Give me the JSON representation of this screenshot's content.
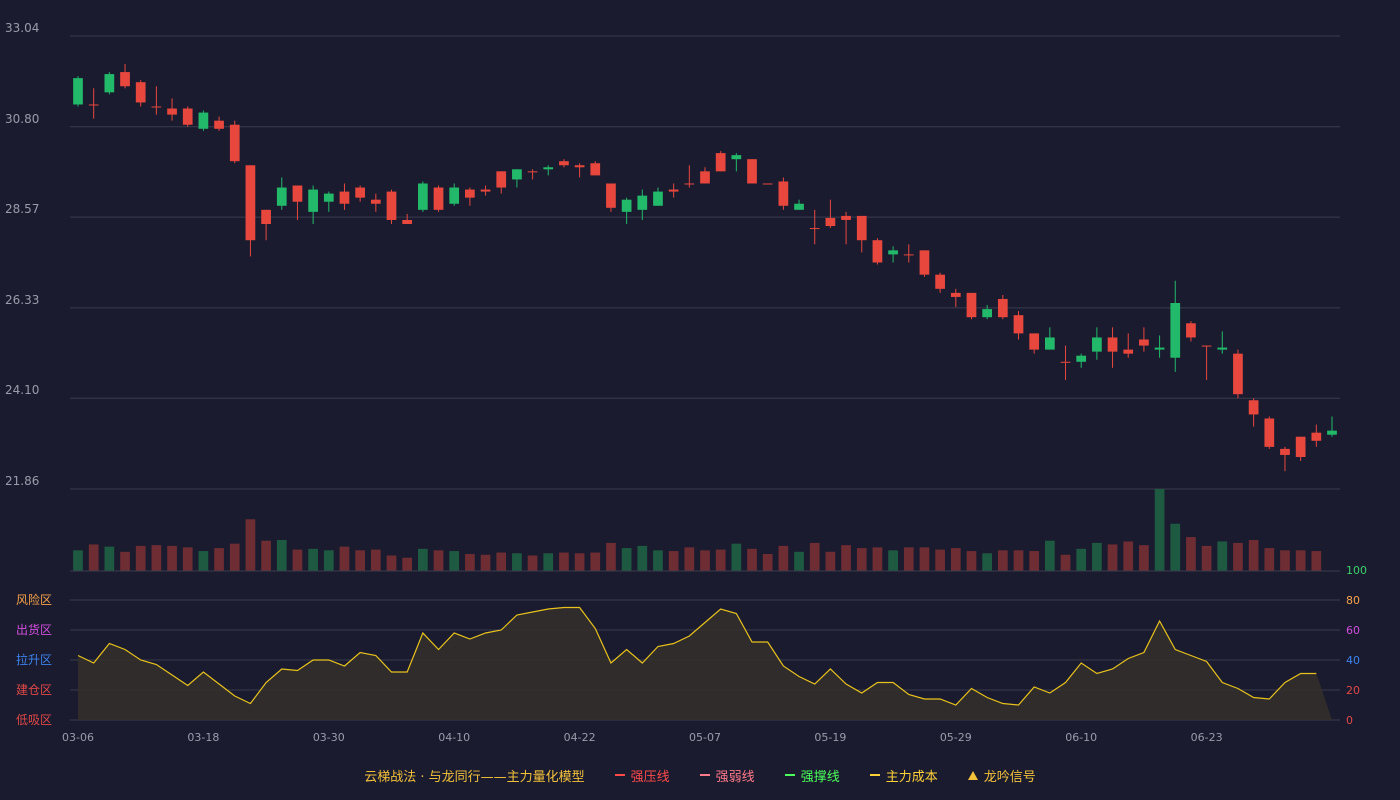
{
  "chart_data": {
    "type": "candlestick",
    "price_axis": {
      "ticks": [
        33.04,
        30.8,
        28.57,
        26.33,
        24.1,
        21.86
      ],
      "ylim": [
        21.86,
        33.04
      ]
    },
    "x_ticks": [
      "03-06",
      "03-18",
      "03-30",
      "04-10",
      "04-22",
      "05-07",
      "05-19",
      "05-29",
      "06-10",
      "06-23"
    ],
    "x_tick_index": [
      0,
      8,
      16,
      24,
      32,
      40,
      48,
      56,
      64,
      72
    ],
    "candles": [
      [
        32.0,
        31.35,
        32.05,
        31.3
      ],
      [
        31.35,
        31.35,
        31.75,
        31.0
      ],
      [
        32.1,
        31.65,
        32.15,
        31.6
      ],
      [
        31.8,
        32.15,
        32.35,
        31.75
      ],
      [
        31.4,
        31.9,
        31.95,
        31.3
      ],
      [
        31.3,
        31.3,
        31.8,
        31.1
      ],
      [
        31.1,
        31.25,
        31.5,
        30.95
      ],
      [
        30.85,
        31.25,
        31.3,
        30.8
      ],
      [
        31.15,
        30.75,
        31.2,
        30.7
      ],
      [
        30.75,
        30.95,
        31.05,
        30.7
      ],
      [
        29.95,
        30.85,
        30.95,
        29.9
      ],
      [
        28.0,
        29.85,
        29.85,
        27.6
      ],
      [
        28.4,
        28.75,
        28.75,
        28.0
      ],
      [
        29.3,
        28.85,
        29.55,
        28.75
      ],
      [
        28.95,
        29.35,
        29.35,
        28.5
      ],
      [
        29.25,
        28.7,
        29.35,
        28.4
      ],
      [
        29.15,
        28.95,
        29.2,
        28.7
      ],
      [
        28.9,
        29.2,
        29.4,
        28.75
      ],
      [
        29.05,
        29.3,
        29.35,
        28.95
      ],
      [
        28.9,
        29.0,
        29.15,
        28.7
      ],
      [
        28.5,
        29.2,
        29.25,
        28.4
      ],
      [
        28.4,
        28.5,
        28.65,
        28.4
      ],
      [
        29.4,
        28.75,
        29.45,
        28.7
      ],
      [
        28.75,
        29.3,
        29.35,
        28.7
      ],
      [
        29.3,
        28.9,
        29.4,
        28.85
      ],
      [
        29.05,
        29.25,
        29.3,
        28.85
      ],
      [
        29.2,
        29.25,
        29.35,
        29.1
      ],
      [
        29.3,
        29.7,
        29.7,
        29.15
      ],
      [
        29.75,
        29.5,
        29.75,
        29.3
      ],
      [
        29.7,
        29.7,
        29.75,
        29.5
      ],
      [
        29.8,
        29.75,
        29.85,
        29.6
      ],
      [
        29.85,
        29.95,
        30.0,
        29.8
      ],
      [
        29.8,
        29.85,
        29.9,
        29.55
      ],
      [
        29.6,
        29.9,
        29.95,
        29.6
      ],
      [
        28.8,
        29.4,
        29.4,
        28.7
      ],
      [
        29.0,
        28.7,
        29.05,
        28.4
      ],
      [
        29.1,
        28.75,
        29.25,
        28.5
      ],
      [
        29.2,
        28.85,
        29.3,
        28.85
      ],
      [
        29.2,
        29.25,
        29.4,
        29.05
      ],
      [
        29.4,
        29.4,
        29.85,
        29.3
      ],
      [
        29.4,
        29.7,
        29.8,
        29.4
      ],
      [
        29.7,
        30.15,
        30.2,
        29.7
      ],
      [
        30.1,
        30.0,
        30.15,
        29.7
      ],
      [
        29.4,
        30.0,
        30.0,
        29.4
      ],
      [
        29.4,
        29.4,
        29.4,
        29.4
      ],
      [
        28.85,
        29.45,
        29.55,
        28.75
      ],
      [
        28.9,
        28.75,
        29.0,
        28.75
      ],
      [
        28.3,
        28.3,
        28.75,
        27.9
      ],
      [
        28.35,
        28.55,
        29.0,
        28.3
      ],
      [
        28.5,
        28.6,
        28.7,
        27.9
      ],
      [
        28.0,
        28.6,
        28.6,
        27.7
      ],
      [
        27.45,
        28.0,
        28.05,
        27.4
      ],
      [
        27.75,
        27.65,
        27.85,
        27.45
      ],
      [
        27.65,
        27.65,
        27.9,
        27.45
      ],
      [
        27.15,
        27.75,
        27.75,
        27.1
      ],
      [
        26.8,
        27.15,
        27.2,
        26.7
      ],
      [
        26.6,
        26.7,
        26.8,
        26.35
      ],
      [
        26.1,
        26.7,
        26.7,
        26.05
      ],
      [
        26.3,
        26.1,
        26.4,
        26.05
      ],
      [
        26.1,
        26.55,
        26.65,
        26.05
      ],
      [
        25.7,
        26.15,
        26.25,
        25.55
      ],
      [
        25.3,
        25.7,
        25.7,
        25.2
      ],
      [
        25.6,
        25.3,
        25.85,
        25.3
      ],
      [
        25.0,
        25.0,
        25.4,
        24.55
      ],
      [
        25.15,
        25.0,
        25.2,
        24.85
      ],
      [
        25.6,
        25.25,
        25.85,
        25.05
      ],
      [
        25.25,
        25.6,
        25.85,
        24.85
      ],
      [
        25.2,
        25.3,
        25.7,
        25.1
      ],
      [
        25.4,
        25.55,
        25.85,
        25.25
      ],
      [
        25.35,
        25.3,
        25.65,
        25.1
      ],
      [
        26.45,
        25.1,
        27.0,
        24.75
      ],
      [
        25.6,
        25.95,
        26.0,
        25.5
      ],
      [
        25.4,
        25.4,
        25.4,
        24.55
      ],
      [
        25.35,
        25.3,
        25.75,
        25.2
      ],
      [
        24.2,
        25.2,
        25.3,
        24.1
      ],
      [
        23.7,
        24.05,
        24.1,
        23.4
      ],
      [
        22.9,
        23.6,
        23.65,
        22.85
      ],
      [
        22.7,
        22.85,
        22.9,
        22.3
      ],
      [
        22.65,
        23.15,
        23.15,
        22.55
      ],
      [
        23.05,
        23.25,
        23.45,
        22.9
      ],
      [
        23.3,
        23.2,
        23.65,
        23.15
      ]
    ],
    "volume": [
      28,
      36,
      33,
      26,
      34,
      35,
      34,
      32,
      27,
      31,
      37,
      70,
      41,
      42,
      29,
      30,
      28,
      33,
      28,
      29,
      21,
      18,
      30,
      28,
      27,
      23,
      22,
      25,
      24,
      21,
      24,
      25,
      24,
      25,
      38,
      31,
      34,
      28,
      27,
      32,
      28,
      29,
      37,
      30,
      23,
      34,
      26,
      38,
      26,
      35,
      31,
      32,
      28,
      32,
      32,
      29,
      31,
      27,
      24,
      28,
      28,
      27,
      41,
      22,
      30,
      38,
      36,
      40,
      35,
      111,
      64,
      46,
      34,
      40,
      38,
      42,
      31,
      28,
      28,
      27
    ],
    "indicator": {
      "zones": [
        {
          "label": "风险区",
          "color": "#f6a24a"
        },
        {
          "label": "出货区",
          "color": "#d24ee0"
        },
        {
          "label": "拉升区",
          "color": "#3d83f0"
        },
        {
          "label": "建仓区",
          "color": "#e04848"
        },
        {
          "label": "低吸区",
          "color": "#e04848"
        }
      ],
      "right_ticks": [
        100,
        80,
        60,
        40,
        20,
        0
      ],
      "right_tick_colors": [
        "#3ad16a",
        "#f6a24a",
        "#d24ee0",
        "#3d83f0",
        "#e04848",
        "#e04848"
      ],
      "ylim": [
        0,
        100
      ],
      "values": [
        43,
        38,
        51,
        47,
        40,
        37,
        30,
        23,
        32,
        24,
        16,
        11,
        25,
        34,
        33,
        40,
        40,
        36,
        45,
        43,
        32,
        32,
        58,
        47,
        58,
        54,
        58,
        60,
        70,
        72,
        74,
        75,
        75,
        61,
        38,
        47,
        38,
        49,
        51,
        56,
        65,
        74,
        71,
        52,
        52,
        36,
        29,
        24,
        34,
        24,
        18,
        25,
        25,
        17,
        14,
        14,
        10,
        21,
        15,
        11,
        10,
        22,
        18,
        25,
        38,
        31,
        34,
        41,
        45,
        66,
        47,
        43,
        39,
        25,
        21,
        15,
        14,
        25,
        31,
        31
      ]
    },
    "legend": [
      {
        "label": "云梯战法 · 与龙同行——主力量化模型",
        "color": "#f3c13a",
        "mark": "none"
      },
      {
        "label": "强压线",
        "color": "#ff4a4a",
        "mark": "solid"
      },
      {
        "label": "强弱线",
        "color": "#ff7a8a",
        "mark": "dash"
      },
      {
        "label": "强撑线",
        "color": "#4aff5a",
        "mark": "solid"
      },
      {
        "label": "主力成本",
        "color": "#ffd23a",
        "mark": "dash"
      },
      {
        "label": "龙吟信号",
        "color": "#f3c13a",
        "mark": "triangle"
      }
    ],
    "colors": {
      "up": "#e8473e",
      "down": "#22b96b",
      "up_vol": "#6e2c33",
      "down_vol": "#1d5a41",
      "grid": "#3a3c4e",
      "axis_text": "#9a9cab",
      "indicator_line": "#e8c21c",
      "indicator_fill": "#332f2b"
    }
  }
}
